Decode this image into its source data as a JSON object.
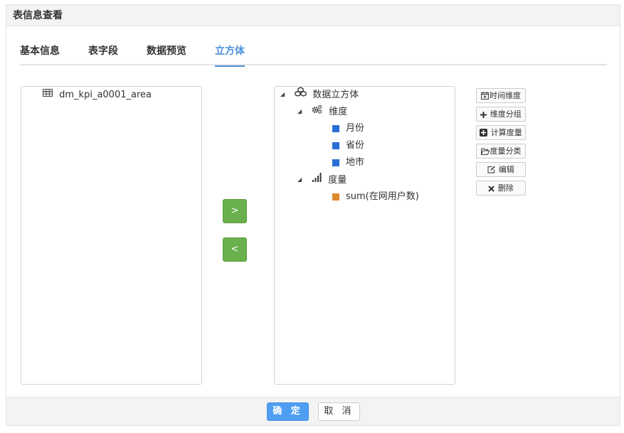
{
  "dialog": {
    "title": "表信息查看"
  },
  "tabs": [
    {
      "label": "基本信息"
    },
    {
      "label": "表字段"
    },
    {
      "label": "数据预览"
    },
    {
      "label": "立方体",
      "active": true
    }
  ],
  "source_tree": {
    "table": {
      "label": "dm_kpi_a0001_area",
      "icon": "table-icon"
    }
  },
  "move_buttons": {
    "add": ">",
    "remove": "<"
  },
  "cube_tree": {
    "root": {
      "label": "数据立方体",
      "icon": "cubes-icon"
    },
    "dimensions": {
      "label": "维度",
      "icon": "cogs-icon",
      "items": [
        {
          "label": "月份",
          "color": "#2a6fd6"
        },
        {
          "label": "省份",
          "color": "#2a6fd6"
        },
        {
          "label": "地市",
          "color": "#2a6fd6"
        }
      ]
    },
    "measures": {
      "label": "度量",
      "icon": "signal-bars-icon",
      "items": [
        {
          "label": "sum(在网用户数)",
          "color": "#e08a2c"
        }
      ]
    }
  },
  "side_buttons": {
    "time_dimension": "时间维度",
    "dimension_group": "维度分组",
    "calc_measure": "计算度量",
    "measure_category": "度量分类",
    "edit": "编辑",
    "delete": "删除"
  },
  "footer": {
    "ok": "确 定",
    "cancel": "取 消"
  },
  "colors": {
    "accent": "#4a90d9",
    "move_green": "#6ab04c",
    "ok_blue": "#4f9ef2"
  }
}
